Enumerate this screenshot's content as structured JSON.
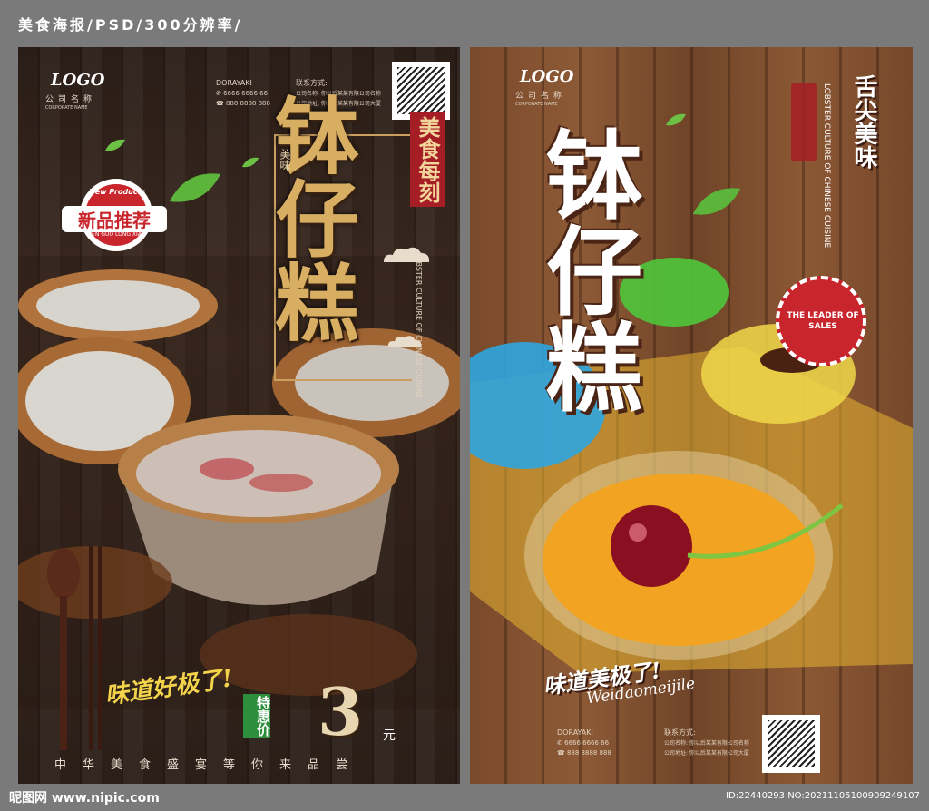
{
  "top_banner": {
    "text": "美食海报/PSD/300分辨率/"
  },
  "poster_left": {
    "logo": "LOGO",
    "company": "公司名称",
    "company_sub": "CORPORATE NAME",
    "brand": "DORAYAKI",
    "phone1": "6666 6666 66",
    "phone2": "888 8888 888",
    "contact_label": "联系方式:",
    "contact_company": "公司名称: 你以后某某有限公司名称",
    "contact_address": "公司地址: 你以后某某有限公司大厦",
    "title": "钵仔糕",
    "vertical_red": "美食每刻",
    "vertical_small": "美味",
    "eng_vertical": "LOBSTER CULTURE OF CHINESE CUISINE",
    "badge_top": "New Products",
    "badge_main": "新品推荐",
    "badge_bottom": "MEN GUO LONG XIA",
    "slogan": "味道好极了!",
    "special_price": "特惠价",
    "price": "3",
    "price_unit": "元",
    "bottom_text": "中华美食盛宴等你来品尝"
  },
  "poster_right": {
    "logo": "LOGO",
    "company": "公司名称",
    "company_sub": "CORPORATE NAME",
    "title": "钵仔糕",
    "vertical_red": "舌尖美味",
    "eng_vertical": "LOBSTER CULTURE OF CHINESE CUISINE",
    "badge_text": "THE LEADER OF SALES",
    "slogan": "味道美极了!",
    "slogan_pinyin": "Weidaomeijile",
    "brand": "DORAYAKI",
    "phone1": "6666 6666 66",
    "phone2": "888 8888 888",
    "contact_label": "联系方式:",
    "contact_company": "公司名称: 你以后某某有限公司名称",
    "contact_address": "公司地址: 你以后某某有限公司大厦"
  },
  "footer": {
    "site": "昵图网 www.nipic.com",
    "id_info": "ID:22440293 NO:20211105100909249107"
  },
  "colors": {
    "red": "#b8202a",
    "gold": "#d9b26a",
    "dark_wood": "#2b1e18",
    "light_wood": "#8d5a36"
  }
}
